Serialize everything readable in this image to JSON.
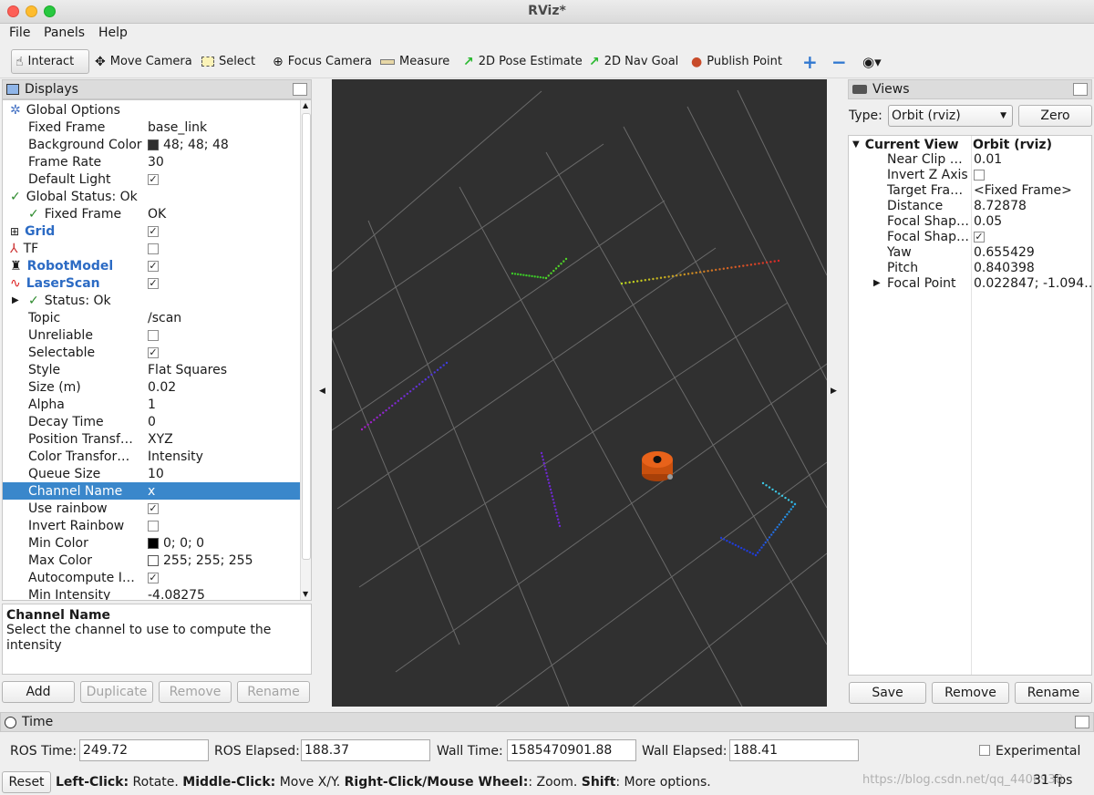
{
  "window": {
    "title": "RViz*"
  },
  "menu": [
    "File",
    "Panels",
    "Help"
  ],
  "toolbar": {
    "interact": "Interact",
    "move_camera": "Move Camera",
    "select": "Select",
    "focus_camera": "Focus Camera",
    "measure": "Measure",
    "pose_estimate": "2D Pose Estimate",
    "nav_goal": "2D Nav Goal",
    "publish_point": "Publish Point"
  },
  "displays": {
    "title": "Displays",
    "rows": [
      {
        "label": "Global Options",
        "value": ""
      },
      {
        "label": "Fixed Frame",
        "value": "base_link"
      },
      {
        "label": "Background Color",
        "value": "48; 48; 48"
      },
      {
        "label": "Frame Rate",
        "value": "30"
      },
      {
        "label": "Default Light",
        "value": ""
      },
      {
        "label": "Global Status: Ok",
        "value": ""
      },
      {
        "label": "Fixed Frame",
        "value": "OK"
      },
      {
        "label": "Grid",
        "value": ""
      },
      {
        "label": "TF",
        "value": ""
      },
      {
        "label": "RobotModel",
        "value": ""
      },
      {
        "label": "LaserScan",
        "value": ""
      },
      {
        "label": "Status: Ok",
        "value": ""
      },
      {
        "label": "Topic",
        "value": "/scan"
      },
      {
        "label": "Unreliable",
        "value": ""
      },
      {
        "label": "Selectable",
        "value": ""
      },
      {
        "label": "Style",
        "value": "Flat Squares"
      },
      {
        "label": "Size (m)",
        "value": "0.02"
      },
      {
        "label": "Alpha",
        "value": "1"
      },
      {
        "label": "Decay Time",
        "value": "0"
      },
      {
        "label": "Position Transf…",
        "value": "XYZ"
      },
      {
        "label": "Color Transfor…",
        "value": "Intensity"
      },
      {
        "label": "Queue Size",
        "value": "10"
      },
      {
        "label": "Channel Name",
        "value": "x"
      },
      {
        "label": "Use rainbow",
        "value": ""
      },
      {
        "label": "Invert Rainbow",
        "value": ""
      },
      {
        "label": "Min Color",
        "value": "0; 0; 0"
      },
      {
        "label": "Max Color",
        "value": "255; 255; 255"
      },
      {
        "label": "Autocompute I…",
        "value": ""
      },
      {
        "label": "Min Intensity",
        "value": "-4.08275"
      }
    ],
    "description_title": "Channel Name",
    "description_text": "Select the channel to use to compute the intensity",
    "buttons": {
      "add": "Add",
      "duplicate": "Duplicate",
      "remove": "Remove",
      "rename": "Rename"
    }
  },
  "colors": {
    "background": "#303030",
    "min_color": "#000000",
    "max_color": "#ffffff",
    "selection": "#3a87cb",
    "robot": "#e0560e"
  },
  "views": {
    "title": "Views",
    "type_label": "Type:",
    "type_value": "Orbit (rviz)",
    "zero": "Zero",
    "header_label": "Current View",
    "header_value": "Orbit (rviz)",
    "rows": [
      {
        "label": "Near Clip …",
        "value": "0.01"
      },
      {
        "label": "Invert Z Axis",
        "value": ""
      },
      {
        "label": "Target Fra…",
        "value": "<Fixed Frame>"
      },
      {
        "label": "Distance",
        "value": "8.72878"
      },
      {
        "label": "Focal Shap…",
        "value": "0.05"
      },
      {
        "label": "Focal Shap…",
        "value": ""
      },
      {
        "label": "Yaw",
        "value": "0.655429"
      },
      {
        "label": "Pitch",
        "value": "0.840398"
      },
      {
        "label": "Focal Point",
        "value": "0.022847; -1.094…"
      }
    ],
    "buttons": {
      "save": "Save",
      "remove": "Remove",
      "rename": "Rename"
    }
  },
  "time": {
    "title": "Time",
    "ros_time_label": "ROS Time:",
    "ros_time": "249.72",
    "ros_elapsed_label": "ROS Elapsed:",
    "ros_elapsed": "188.37",
    "wall_time_label": "Wall Time:",
    "wall_time": "1585470901.88",
    "wall_elapsed_label": "Wall Elapsed:",
    "wall_elapsed": "188.41",
    "experimental": "Experimental"
  },
  "status": {
    "reset": "Reset",
    "k1": "Left-Click:",
    "t1": " Rotate. ",
    "k2": "Middle-Click:",
    "t2": " Move X/Y. ",
    "k3": "Right-Click/Mouse Wheel:",
    "t3": ": Zoom. ",
    "k4": "Shift",
    "t4": ": More options.",
    "fps": "31 fps",
    "watermark": "https://blog.csdn.net/qq_4406938"
  }
}
